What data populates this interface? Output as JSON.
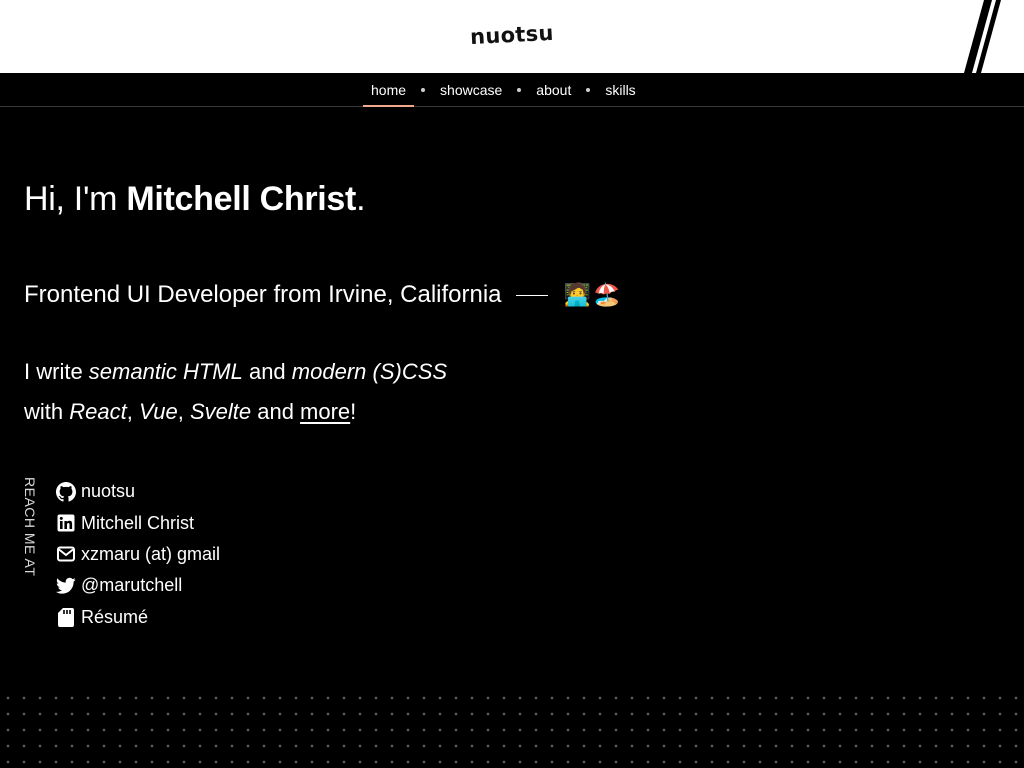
{
  "header": {
    "logo_text": "nuotsu"
  },
  "nav": {
    "items": [
      {
        "label": "home",
        "active": true
      },
      {
        "label": "showcase"
      },
      {
        "label": "about"
      },
      {
        "label": "skills"
      }
    ]
  },
  "hero": {
    "greeting": "Hi, I'm ",
    "name": "Mitchell Christ",
    "period": ".",
    "tagline": "Frontend UI Developer from Irvine, California",
    "emoji_1": "🧑‍💻",
    "emoji_2": "🏖️"
  },
  "intro": {
    "line1_a": "I write ",
    "line1_b": "semantic HTML",
    "line1_c": " and ",
    "line1_d": "modern (S)CSS",
    "line2_a": "with ",
    "line2_b": "React",
    "line2_c": ", ",
    "line2_d": "Vue",
    "line2_e": ", ",
    "line2_f": "Svelte",
    "line2_g": " and ",
    "line2_link": "more",
    "line2_end": "!"
  },
  "contacts": {
    "label": "REACH ME AT",
    "items": [
      {
        "icon": "github-icon",
        "label": "nuotsu"
      },
      {
        "icon": "linkedin-icon",
        "label": "Mitchell Christ"
      },
      {
        "icon": "email-icon",
        "label": "xzmaru (at) gmail"
      },
      {
        "icon": "twitter-icon",
        "label": "@marutchell"
      },
      {
        "icon": "sd-card-icon",
        "label": "Résumé"
      }
    ]
  },
  "colors": {
    "background": "#000000",
    "header_bg": "#ffffff",
    "nav_active_underline": "#f0a98a",
    "text": "#ffffff"
  }
}
